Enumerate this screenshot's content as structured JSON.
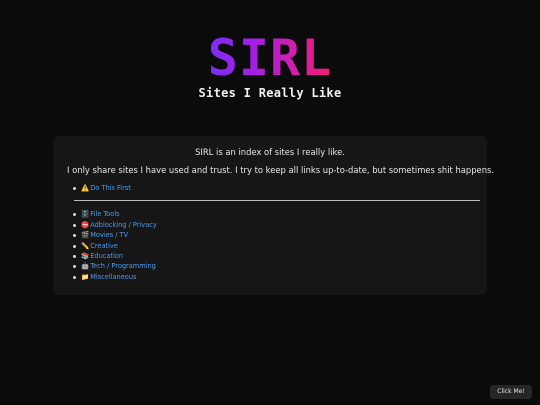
{
  "header": {
    "logo": "SIRL",
    "tagline": "Sites I Really Like"
  },
  "card": {
    "intro": "SIRL is an index of sites I really like.",
    "description": "I only share sites I have used and trust. I try to keep all links up-to-date, but sometimes shit happens.",
    "first_link": {
      "emoji": "⚠️",
      "label": "Do This First"
    },
    "categories": [
      {
        "emoji": "🗄️",
        "label": "File Tools"
      },
      {
        "emoji": "⛔",
        "label": "Adblocking / Privacy"
      },
      {
        "emoji": "🎬",
        "label": "Movies / TV"
      },
      {
        "emoji": "✏️",
        "label": "Creative"
      },
      {
        "emoji": "📚",
        "label": "Education"
      },
      {
        "emoji": "🤖",
        "label": "Tech / Programming"
      },
      {
        "emoji": "📁",
        "label": "Miscellaneous"
      }
    ]
  },
  "button": {
    "label": "Click Me!"
  },
  "colors": {
    "background": "#0b0b0b",
    "card": "#161616",
    "link": "#4a9cf0",
    "logo_gradient": [
      "#7b2ff7",
      "#f11d6f"
    ]
  }
}
